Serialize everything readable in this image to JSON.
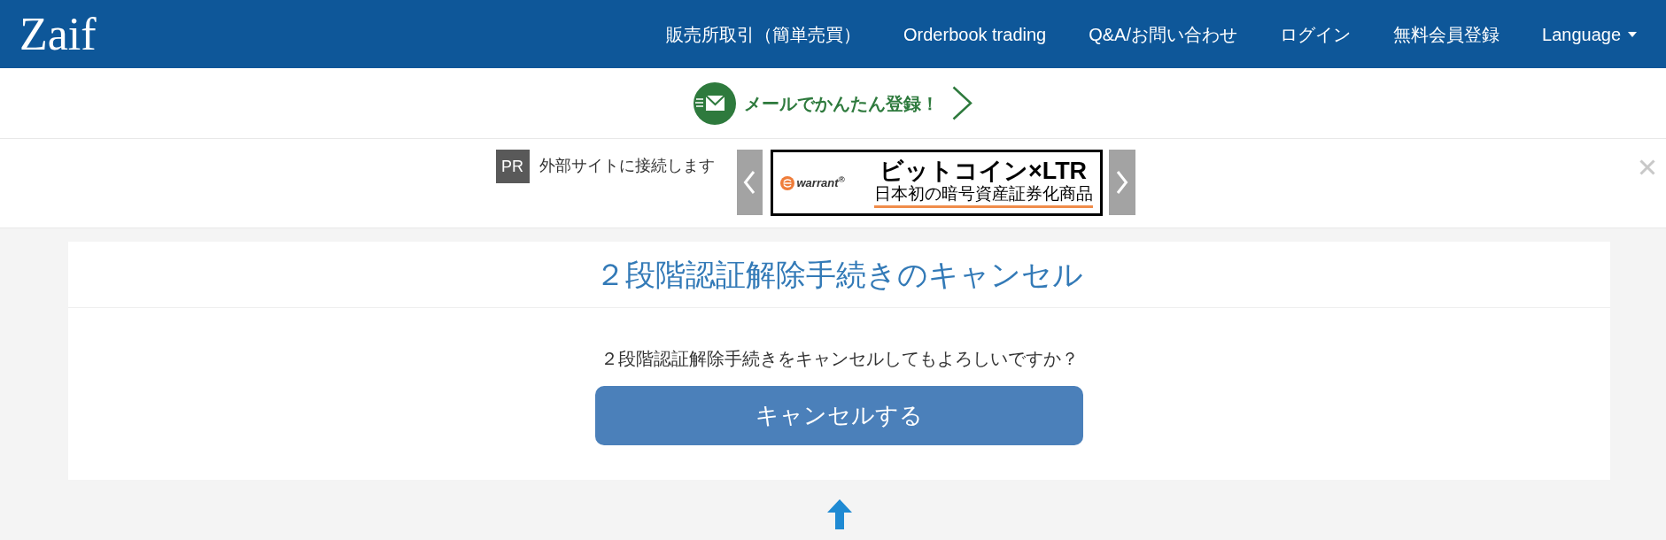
{
  "header": {
    "logo": "Zaif",
    "nav": [
      {
        "label": "販売所取引（簡単売買）",
        "kind": "link"
      },
      {
        "label": "Orderbook trading",
        "kind": "link"
      },
      {
        "label": "Q&A/お問い合わせ",
        "kind": "link"
      },
      {
        "label": "ログイン",
        "kind": "link"
      },
      {
        "label": "無料会員登録",
        "kind": "link"
      },
      {
        "label": "Language",
        "kind": "dropdown"
      }
    ]
  },
  "promo": {
    "text": "メールでかんたん登録！"
  },
  "ad_bar": {
    "badge": "PR",
    "notice": "外部サイトに接続します",
    "banner": {
      "brand": "warrant$^{®}$",
      "headline": "ビットコイン×LTR",
      "subline": "日本初の暗号資産証券化商品"
    }
  },
  "card": {
    "title": "２段階認証解除手続きのキャンセル",
    "message": "２段階認証解除手続きをキャンセルしてもよろしいですか？",
    "button": "キャンセルする"
  }
}
